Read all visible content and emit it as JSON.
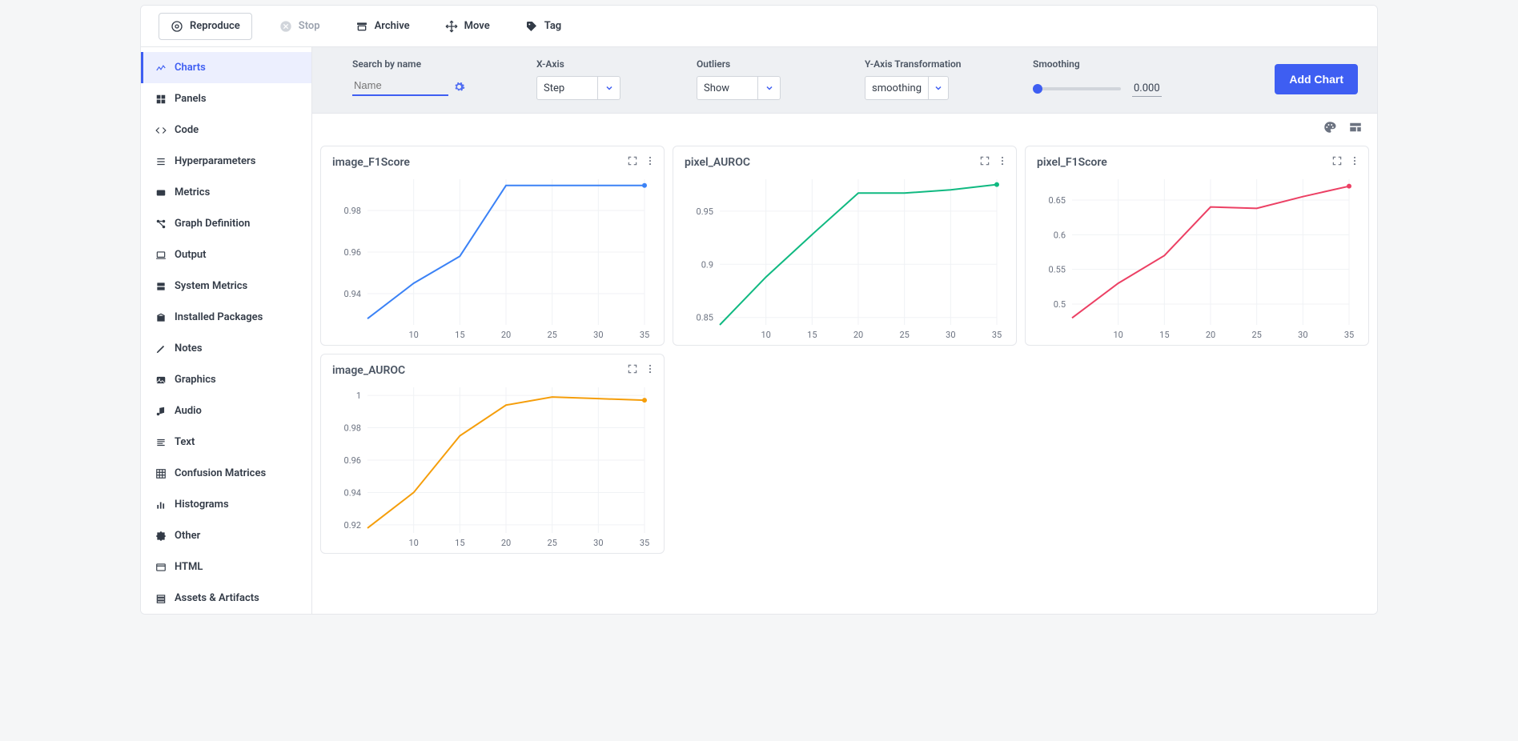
{
  "toolbar": {
    "reproduce": "Reproduce",
    "stop": "Stop",
    "archive": "Archive",
    "move": "Move",
    "tag": "Tag"
  },
  "sidebar": {
    "items": [
      {
        "label": "Charts",
        "icon": "chart"
      },
      {
        "label": "Panels",
        "icon": "grid"
      },
      {
        "label": "Code",
        "icon": "code"
      },
      {
        "label": "Hyperparameters",
        "icon": "list"
      },
      {
        "label": "Metrics",
        "icon": "card"
      },
      {
        "label": "Graph Definition",
        "icon": "nodes"
      },
      {
        "label": "Output",
        "icon": "laptop"
      },
      {
        "label": "System Metrics",
        "icon": "server"
      },
      {
        "label": "Installed Packages",
        "icon": "package"
      },
      {
        "label": "Notes",
        "icon": "pencil"
      },
      {
        "label": "Graphics",
        "icon": "image"
      },
      {
        "label": "Audio",
        "icon": "music"
      },
      {
        "label": "Text",
        "icon": "text"
      },
      {
        "label": "Confusion Matrices",
        "icon": "grid4"
      },
      {
        "label": "Histograms",
        "icon": "bars"
      },
      {
        "label": "Other",
        "icon": "puzzle"
      },
      {
        "label": "HTML",
        "icon": "window"
      },
      {
        "label": "Assets & Artifacts",
        "icon": "rows"
      }
    ],
    "active_index": 0
  },
  "controls": {
    "search_label": "Search by name",
    "search_placeholder": "Name",
    "xaxis_label": "X-Axis",
    "xaxis_value": "Step",
    "outliers_label": "Outliers",
    "outliers_value": "Show",
    "ytrans_label": "Y-Axis Transformation",
    "ytrans_value": "smoothing",
    "smoothing_label": "Smoothing",
    "smoothing_value": "0.000",
    "add_chart": "Add Chart"
  },
  "chart_data": [
    {
      "title": "image_F1Score",
      "type": "line",
      "color": "#3b82f6",
      "x": [
        5,
        10,
        15,
        20,
        25,
        30,
        35
      ],
      "values": [
        0.928,
        0.945,
        0.958,
        0.992,
        0.992,
        0.992,
        0.992
      ],
      "x_ticks": [
        10,
        15,
        20,
        25,
        30,
        35
      ],
      "y_ticks": [
        0.94,
        0.96,
        0.98
      ],
      "xlim": [
        5,
        35
      ],
      "ylim": [
        0.925,
        0.995
      ],
      "xlabel": "",
      "ylabel": ""
    },
    {
      "title": "pixel_AUROC",
      "type": "line",
      "color": "#10b981",
      "x": [
        5,
        10,
        15,
        20,
        25,
        30,
        35
      ],
      "values": [
        0.843,
        0.888,
        0.928,
        0.967,
        0.967,
        0.97,
        0.975
      ],
      "x_ticks": [
        10,
        15,
        20,
        25,
        30,
        35
      ],
      "y_ticks": [
        0.85,
        0.9,
        0.95
      ],
      "xlim": [
        5,
        35
      ],
      "ylim": [
        0.843,
        0.98
      ],
      "xlabel": "",
      "ylabel": ""
    },
    {
      "title": "pixel_F1Score",
      "type": "line",
      "color": "#ec4064",
      "x": [
        5,
        10,
        15,
        20,
        25,
        30,
        35
      ],
      "values": [
        0.48,
        0.53,
        0.57,
        0.64,
        0.638,
        0.655,
        0.67
      ],
      "x_ticks": [
        10,
        15,
        20,
        25,
        30,
        35
      ],
      "y_ticks": [
        0.5,
        0.55,
        0.6,
        0.65
      ],
      "xlim": [
        5,
        35
      ],
      "ylim": [
        0.47,
        0.68
      ],
      "xlabel": "",
      "ylabel": ""
    },
    {
      "title": "image_AUROC",
      "type": "line",
      "color": "#f59e0b",
      "x": [
        5,
        10,
        15,
        20,
        25,
        30,
        35
      ],
      "values": [
        0.918,
        0.94,
        0.975,
        0.994,
        0.999,
        0.998,
        0.997
      ],
      "x_ticks": [
        10,
        15,
        20,
        25,
        30,
        35
      ],
      "y_ticks": [
        0.92,
        0.94,
        0.96,
        0.98,
        1
      ],
      "xlim": [
        5,
        35
      ],
      "ylim": [
        0.915,
        1.005
      ],
      "xlabel": "",
      "ylabel": ""
    }
  ]
}
